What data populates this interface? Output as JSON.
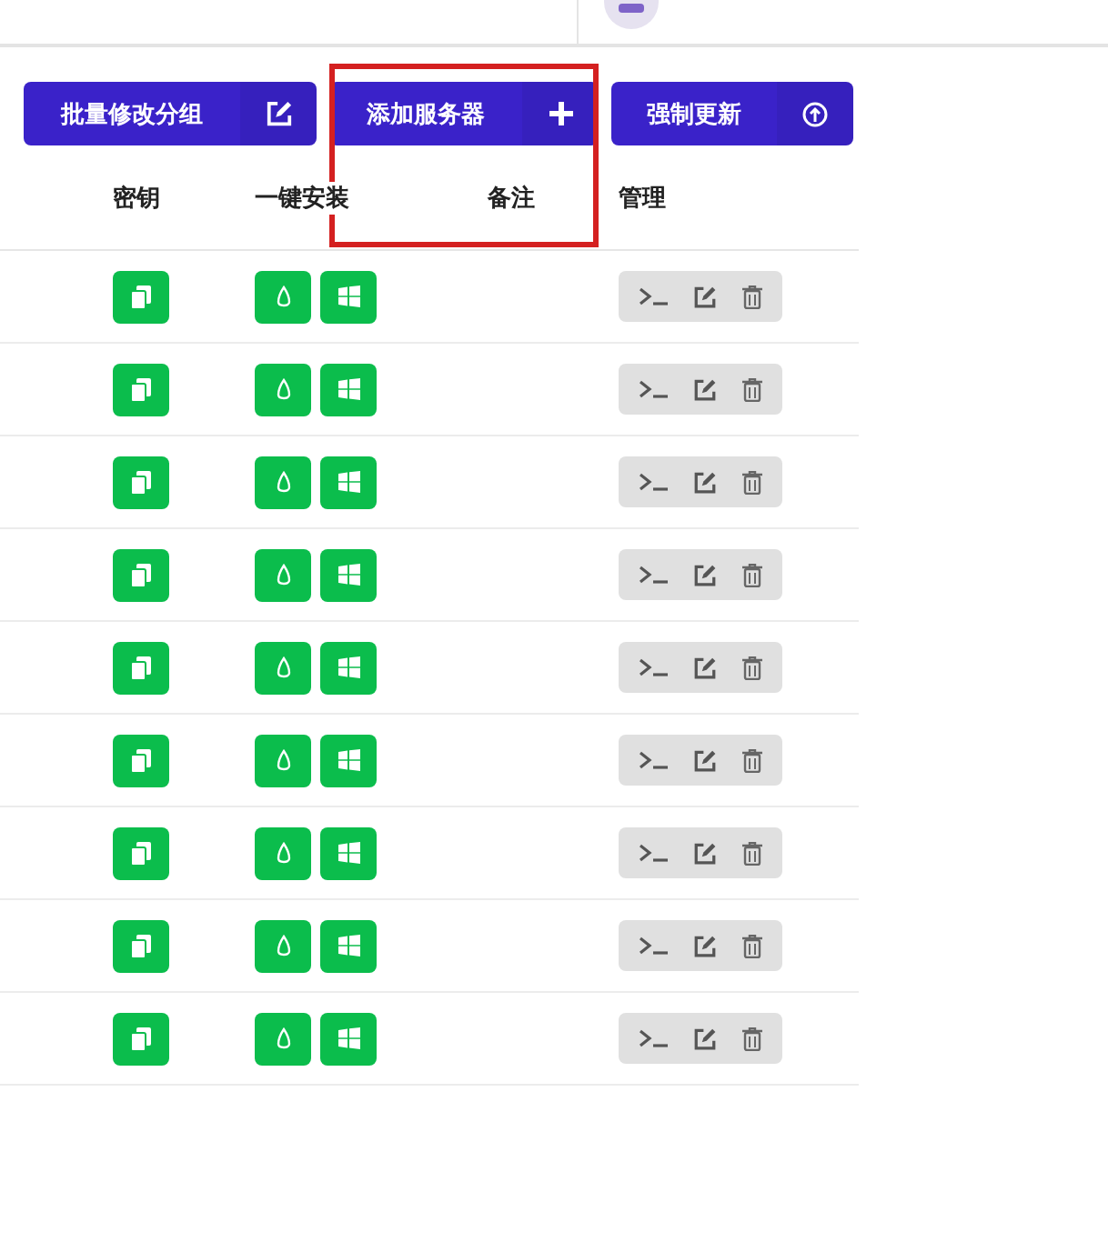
{
  "toolbar": [
    {
      "label": "批量修改分组",
      "kind": "edit"
    },
    {
      "label": "添加服务器",
      "kind": "plus"
    },
    {
      "label": "强制更新",
      "kind": "update"
    }
  ],
  "table": {
    "columns": [
      "密钥",
      "一键安装",
      "备注",
      "管理"
    ],
    "rows": [
      {
        "kind": "server"
      },
      {
        "kind": "server"
      },
      {
        "kind": "server"
      },
      {
        "kind": "server"
      },
      {
        "kind": "server"
      },
      {
        "kind": "server"
      },
      {
        "kind": "server"
      },
      {
        "kind": "server"
      },
      {
        "kind": "server"
      }
    ]
  }
}
